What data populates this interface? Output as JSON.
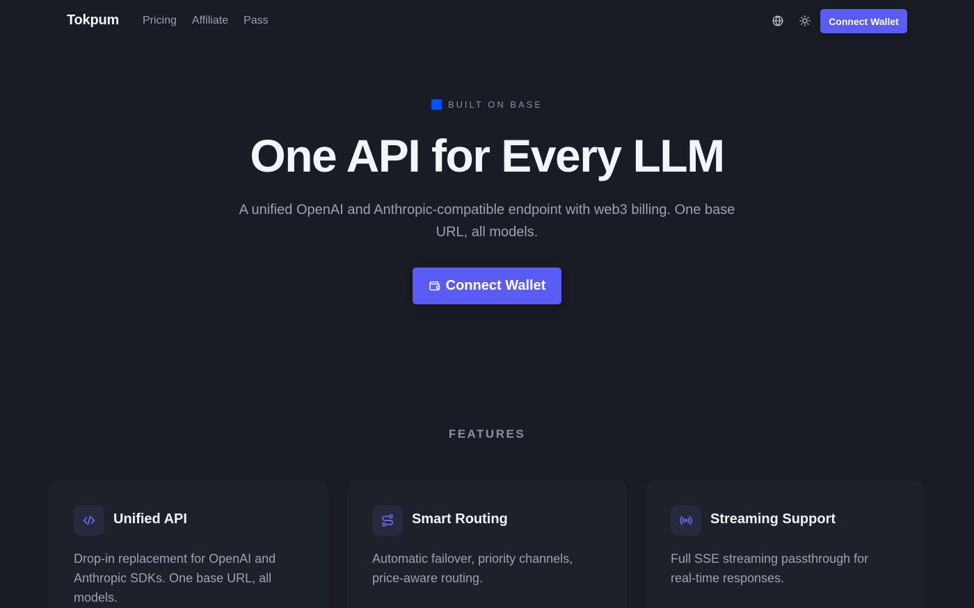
{
  "header": {
    "brand": "Tokpum",
    "nav": [
      {
        "label": "Pricing"
      },
      {
        "label": "Affiliate"
      },
      {
        "label": "Pass"
      }
    ],
    "globe_icon": "globe-icon",
    "theme_icon": "sun-icon",
    "connect_label": "Connect Wallet"
  },
  "hero": {
    "badge": "BUILT ON BASE",
    "title": "One API for Every LLM",
    "subtitle": "A unified OpenAI and Anthropic-compatible endpoint with web3 billing. One base URL, all models.",
    "cta_label": "Connect Wallet",
    "cta_icon": "wallet-icon"
  },
  "features": {
    "label": "FEATURES",
    "cards": [
      {
        "icon": "code-icon",
        "title": "Unified API",
        "description": "Drop-in replacement for OpenAI and Anthropic SDKs. One base URL, all models."
      },
      {
        "icon": "route-icon",
        "title": "Smart Routing",
        "description": "Automatic failover, priority channels, price-aware routing."
      },
      {
        "icon": "broadcast-icon",
        "title": "Streaming Support",
        "description": "Full SSE streaming passthrough for real-time responses."
      }
    ]
  },
  "colors": {
    "background": "#191c24",
    "accent": "#5b5cf6",
    "base_blue": "#0052ff",
    "card": "#1d212a"
  }
}
